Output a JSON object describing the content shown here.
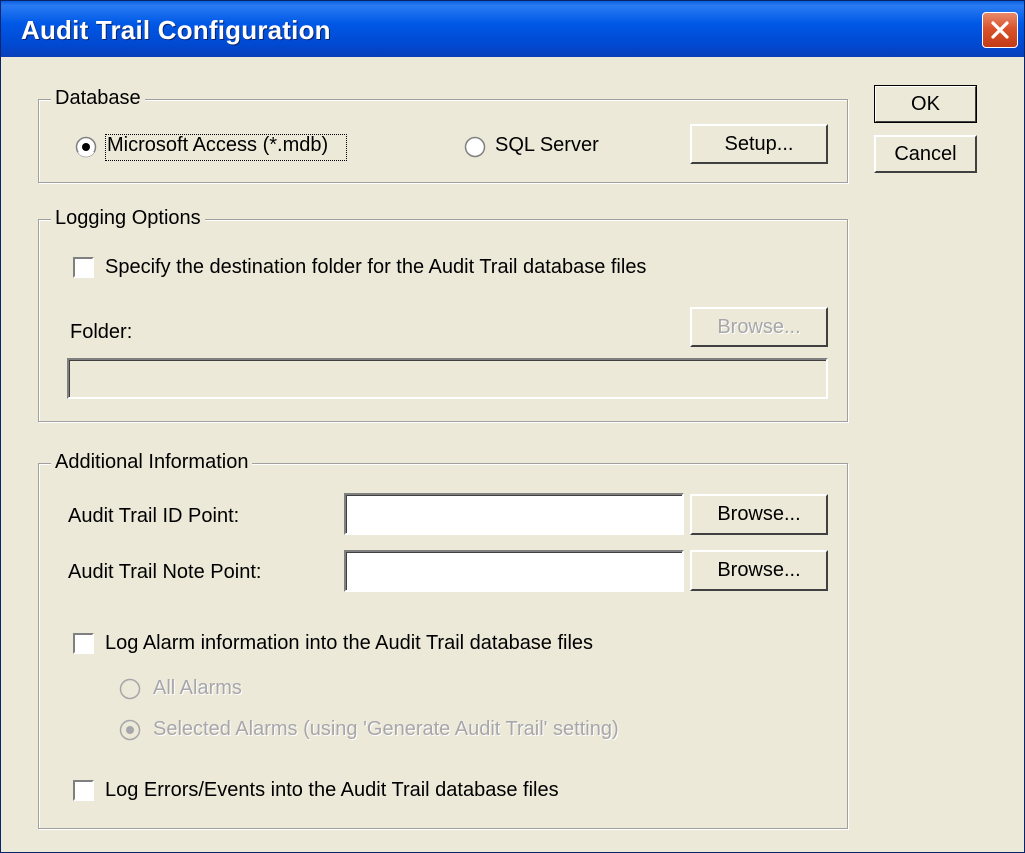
{
  "window": {
    "title": "Audit Trail Configuration"
  },
  "buttons": {
    "ok": "OK",
    "cancel": "Cancel"
  },
  "database": {
    "legend": "Database",
    "options": {
      "access": "Microsoft Access (*.mdb)",
      "sql": "SQL Server"
    },
    "selected": "access",
    "setup": "Setup..."
  },
  "logging": {
    "legend": "Logging Options",
    "specify_label": "Specify the destination folder for the Audit Trail database files",
    "specify_checked": false,
    "folder_label": "Folder:",
    "folder_value": "",
    "browse": "Browse..."
  },
  "additional": {
    "legend": "Additional Information",
    "id_point_label": "Audit Trail ID Point:",
    "id_point_value": "",
    "note_point_label": "Audit Trail Note Point:",
    "note_point_value": "",
    "browse": "Browse...",
    "log_alarm_label": "Log Alarm information into the Audit Trail database files",
    "log_alarm_checked": false,
    "all_alarms": "All Alarms",
    "selected_alarms": "Selected Alarms (using 'Generate Audit Trail' setting)",
    "alarm_selected": "selected",
    "log_errors_label": "Log Errors/Events into the Audit Trail database files",
    "log_errors_checked": false
  }
}
